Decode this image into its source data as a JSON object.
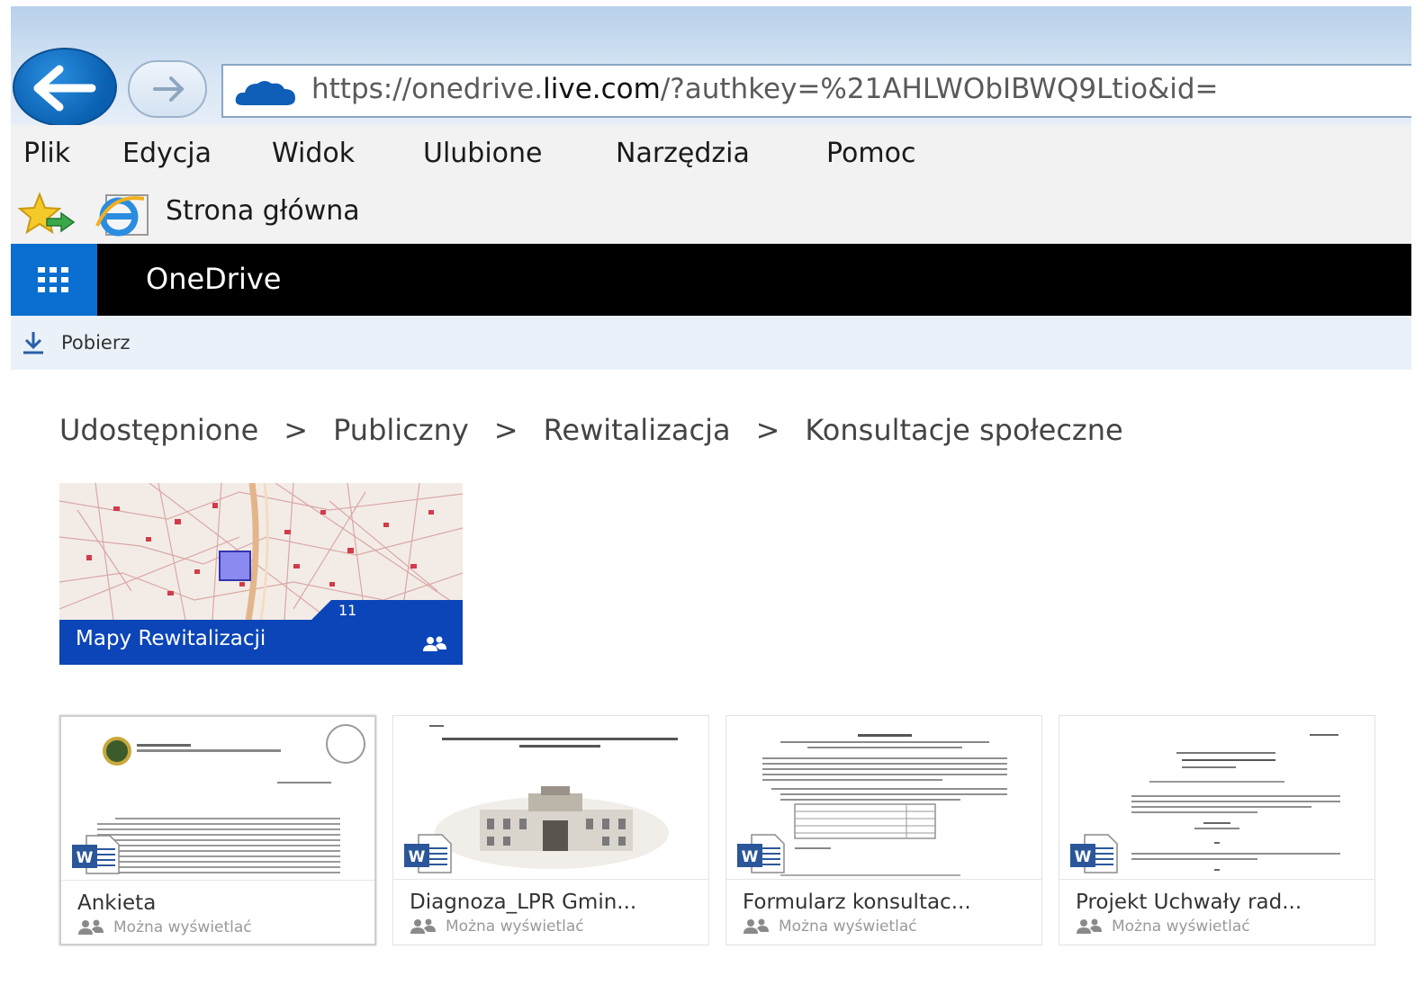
{
  "browser": {
    "url_prefix": "https://onedrive.",
    "url_domain": "live.com",
    "url_suffix": "/?authkey=%21AHLWObIBWQ9Ltio&id=",
    "menu": [
      "Plik",
      "Edycja",
      "Widok",
      "Ulubione",
      "Narzędzia",
      "Pomoc"
    ],
    "favorites_label": "Strona główna"
  },
  "suite": {
    "brand": "OneDrive"
  },
  "command_bar": {
    "download_label": "Pobierz"
  },
  "breadcrumb": [
    "Udostępnione",
    "Publiczny",
    "Rewitalizacja",
    "Konsultacje społeczne"
  ],
  "breadcrumb_separator": ">",
  "folder": {
    "name": "Mapy Rewitalizacji",
    "count": "11"
  },
  "files": [
    {
      "name": "Ankieta",
      "status": "Można wyświetlać"
    },
    {
      "name": "Diagnoza_LPR Gmin...",
      "status": "Można wyświetlać"
    },
    {
      "name": "Formularz konsultac...",
      "status": "Można wyświetlać"
    },
    {
      "name": "Projekt Uchwały rad...",
      "status": "Można wyświetlać"
    }
  ],
  "colors": {
    "suite_bar": "#000000",
    "waffle": "#0a6fd0",
    "folder_bar": "#0b45b8",
    "word_blue": "#2b579a"
  }
}
